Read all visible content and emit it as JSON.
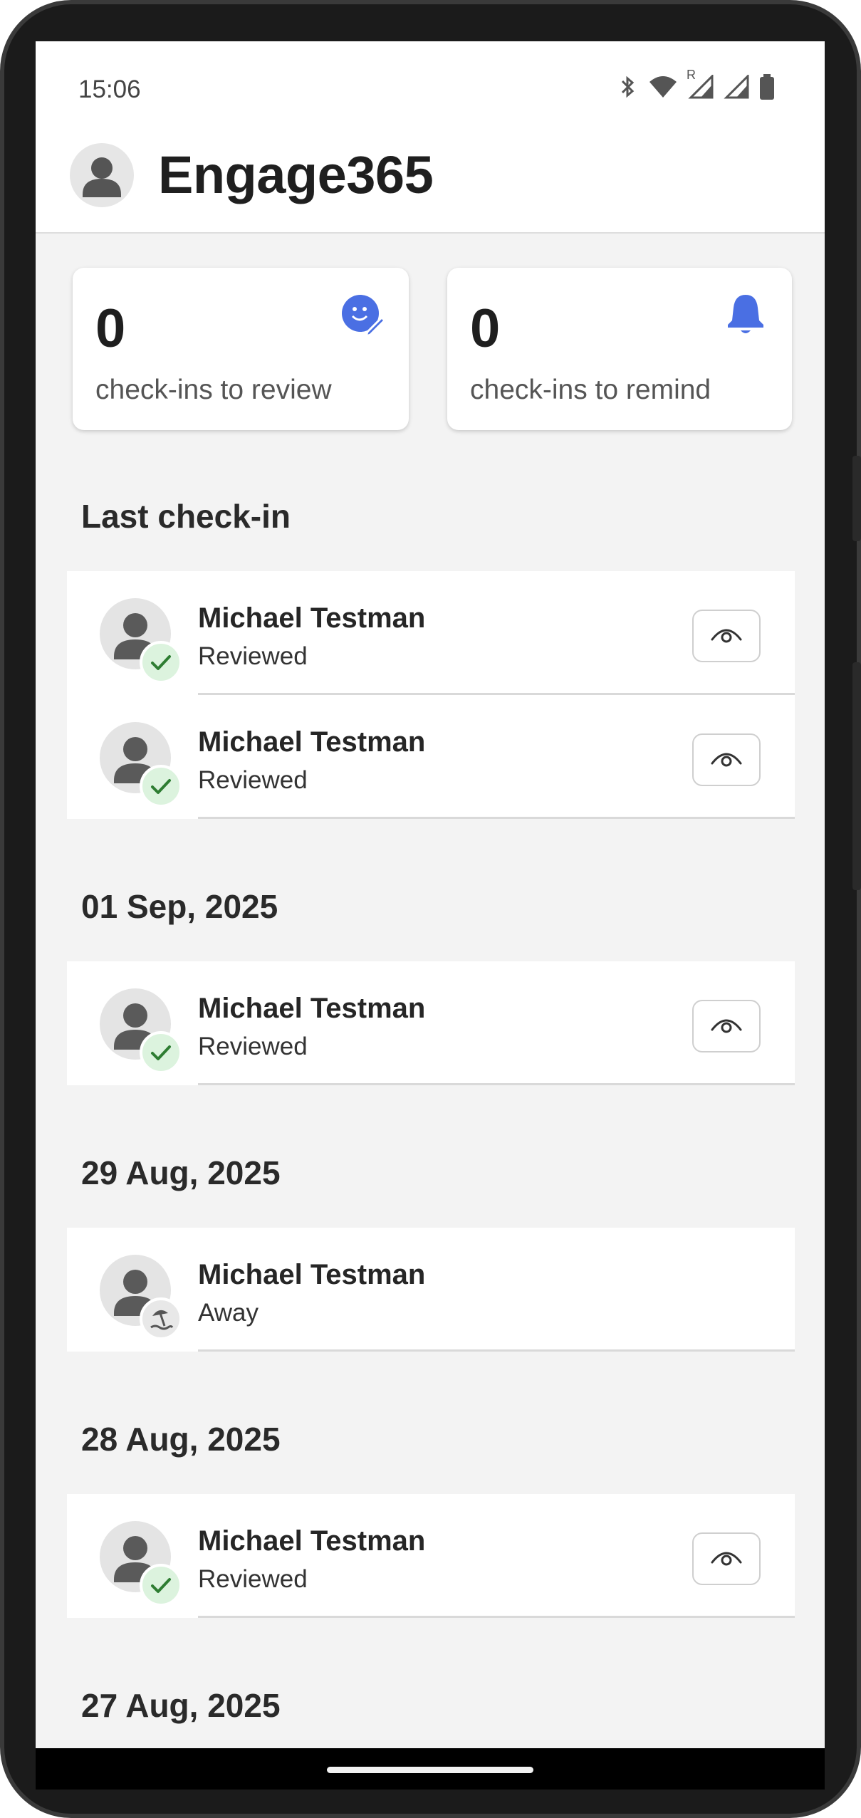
{
  "status_bar": {
    "time": "15:06",
    "icons": [
      "bluetooth-icon",
      "wifi-icon",
      "signal-roaming-icon",
      "signal-icon",
      "battery-icon"
    ],
    "roaming_label": "R"
  },
  "app_bar": {
    "title": "Engage365",
    "avatar_icon": "person-icon"
  },
  "summary": {
    "review": {
      "count": "0",
      "label": "check-ins to review",
      "icon": "smiley-edit-icon"
    },
    "remind": {
      "count": "0",
      "label": "check-ins to remind",
      "icon": "bell-icon"
    }
  },
  "colors": {
    "accent": "#4A6FE3",
    "reviewed_badge": "#DCF3DE",
    "check_green": "#2E7D32",
    "background": "#F3F3F3"
  },
  "sections": [
    {
      "title": "Last check-in",
      "items": [
        {
          "name": "Michael Testman",
          "status": "Reviewed",
          "badge": "check-icon",
          "has_view": true
        },
        {
          "name": "Michael Testman",
          "status": "Reviewed",
          "badge": "check-icon",
          "has_view": true
        }
      ]
    },
    {
      "title": "01 Sep, 2025",
      "items": [
        {
          "name": "Michael Testman",
          "status": "Reviewed",
          "badge": "check-icon",
          "has_view": true
        }
      ]
    },
    {
      "title": "29 Aug, 2025",
      "items": [
        {
          "name": "Michael Testman",
          "status": "Away",
          "badge": "beach-umbrella-icon",
          "has_view": false
        }
      ]
    },
    {
      "title": "28 Aug, 2025",
      "items": [
        {
          "name": "Michael Testman",
          "status": "Reviewed",
          "badge": "check-icon",
          "has_view": true
        }
      ]
    },
    {
      "title": "27 Aug, 2025",
      "items": []
    }
  ]
}
